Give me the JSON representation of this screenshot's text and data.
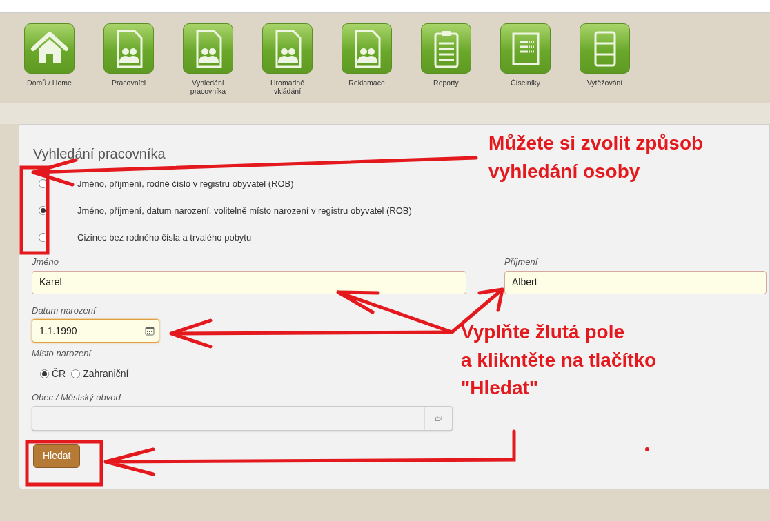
{
  "toolbar": [
    {
      "label": "Domů / Home",
      "kind": "home"
    },
    {
      "label": "Pracovníci",
      "kind": "people"
    },
    {
      "label": "Vyhledání pracovníka",
      "kind": "people"
    },
    {
      "label": "Hromadné vkládání",
      "kind": "people"
    },
    {
      "label": "Reklamace",
      "kind": "people"
    },
    {
      "label": "Reporty",
      "kind": "clipboard"
    },
    {
      "label": "Číselníky",
      "kind": "numbers"
    },
    {
      "label": "Vytěžování",
      "kind": "list"
    }
  ],
  "panel": {
    "title": "Vyhledání pracovníka",
    "search_modes": [
      {
        "label": "Jméno, příjmení, rodné číslo v registru obyvatel (ROB)",
        "selected": false
      },
      {
        "label": "Jméno, příjmení, datum narození, volitelně místo narození v registru obyvatel (ROB)",
        "selected": true
      },
      {
        "label": "Cizinec bez rodného čísla a trvalého pobytu",
        "selected": false
      }
    ],
    "first_name": {
      "label": "Jméno",
      "value": "Karel"
    },
    "surname": {
      "label": "Příjmení",
      "value": "Albert"
    },
    "birth_date": {
      "label": "Datum narození",
      "value": "1.1.1990"
    },
    "birthplace": {
      "label": "Místo narození",
      "options": [
        {
          "label": "ČR",
          "selected": true
        },
        {
          "label": "Zahraniční",
          "selected": false
        }
      ]
    },
    "municipality": {
      "label": "Obec / Městský obvod"
    },
    "search_button": "Hledat"
  },
  "annotations": [
    {
      "lines": [
        "Můžete si zvolit způsob",
        "vyhledání osoby"
      ]
    },
    {
      "lines": [
        "Vyplňte žlutá pole",
        "a klikntěte na tlačítko",
        "\"Hledat\""
      ]
    }
  ]
}
